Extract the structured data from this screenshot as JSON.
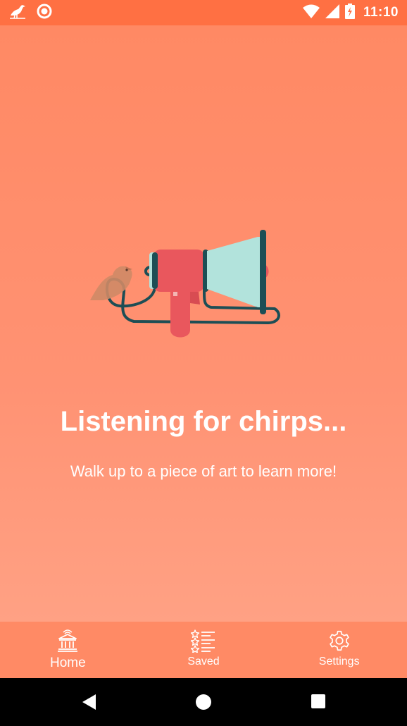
{
  "status_bar": {
    "time": "11:10",
    "left_icons": [
      "bird-icon",
      "record-icon"
    ],
    "right_icons": [
      "wifi-icon",
      "signal-icon",
      "battery-charging-icon"
    ]
  },
  "main": {
    "illustration": "megaphone-bird-illustration",
    "title": "Listening for chirps...",
    "subtitle": "Walk up to a piece of art to learn more!"
  },
  "bottom_nav": {
    "items": [
      {
        "label": "Home",
        "icon": "museum-icon",
        "active": true
      },
      {
        "label": "Saved",
        "icon": "starred-list-icon",
        "active": false
      },
      {
        "label": "Settings",
        "icon": "gear-icon",
        "active": false
      }
    ]
  },
  "system_nav": [
    "back-icon",
    "home-circle-icon",
    "recents-square-icon"
  ],
  "colors": {
    "status_bar": "#ff7043",
    "background": "#ff8a65",
    "megaphone_red": "#e9575d",
    "megaphone_mint": "#b2e3dc",
    "cable_dark": "#1d4e55"
  }
}
